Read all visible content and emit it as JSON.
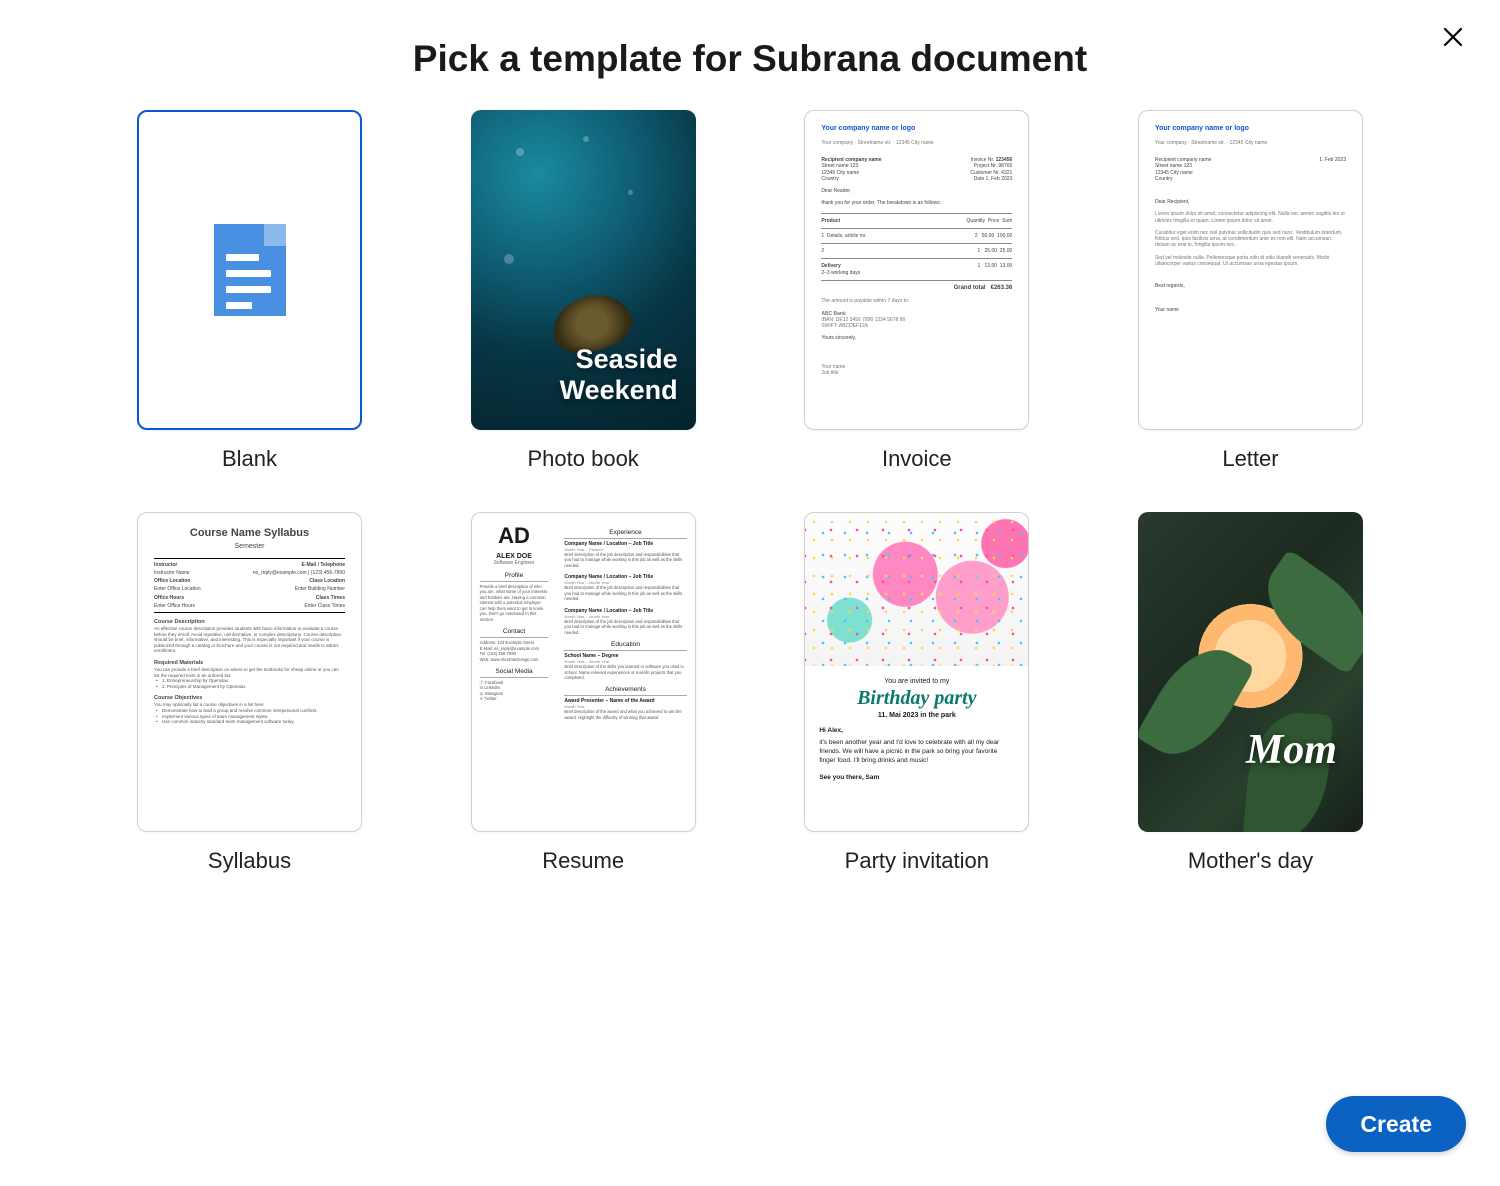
{
  "dialog": {
    "title": "Pick a template for Subrana document"
  },
  "templates": [
    {
      "label": "Blank",
      "selected": true
    },
    {
      "label": "Photo book",
      "overlay_line1": "Seaside",
      "overlay_line2": "Weekend"
    },
    {
      "label": "Invoice",
      "header": "Your company name or logo",
      "invoice_no_label": "Invoice Nr.",
      "invoice_no": "123456",
      "date_label": "Date",
      "date": "1. Feb 2023",
      "recipient_title": "Recipient company name",
      "greeting": "Dear Reader,",
      "intro": "thank you for your order. The breakdown is as follows:",
      "cols": [
        "Product",
        "Quantity",
        "Price",
        "Sum"
      ],
      "items": [
        {
          "name": "Details, article no.",
          "qty": 2,
          "price": "50.00",
          "sum": "100.00"
        },
        {
          "name": "",
          "qty": 1,
          "price": "25.00",
          "sum": "25.00"
        }
      ],
      "delivery_label": "Delivery",
      "delivery_desc": "2–3 working days",
      "grand_label": "Grand total",
      "grand": "€263.36",
      "signoff": "Yours sincerely,"
    },
    {
      "label": "Letter",
      "header": "Your company name or logo",
      "date": "1. Feb 2023",
      "greeting": "Dear Recipient,",
      "closing": "Best regards,",
      "signature": "Your name"
    },
    {
      "label": "Syllabus",
      "title": "Course Name Syllabus",
      "term": "Semester",
      "left_labels": [
        "Instructor",
        "Instructor Name",
        "Office Location",
        "Enter Office Location",
        "Office Hours",
        "Enter Office Hours"
      ],
      "right_labels": [
        "E-Mail / Telephone",
        "no_reply@example.com | (123) 456-7890",
        "Class Location",
        "Enter Building Number",
        "Class Times",
        "Enter Class Times"
      ],
      "sections": [
        "Course Description",
        "Required Materials",
        "Course Objectives"
      ]
    },
    {
      "label": "Resume",
      "initials": "AD",
      "name": "ALEX DOE",
      "role": "Software Engineer",
      "left_sections": [
        "Profile",
        "Contact",
        "Social Media"
      ],
      "right_sections": [
        "Experience",
        "Education",
        "Achievements"
      ],
      "job_line": "Company Name / Location – Job Title",
      "date_line": "Month Year – Present",
      "edu_line": "School Name – Degree",
      "award_line": "Award Presenter – Name of the Award",
      "socials": [
        "Facebook",
        "LinkedIn",
        "Instagram",
        "Twitter"
      ]
    },
    {
      "label": "Party invitation",
      "preline": "You are invited to my",
      "title": "Birthday party",
      "date": "11. Mai 2023 in the park",
      "hi": "Hi Alex,",
      "body": "it's been another year and I'd love to celebrate with all my dear friends. We will have a picnic in the park so bring your favorite finger food. I'll bring drinks and music!",
      "bye": "See you there, Sam"
    },
    {
      "label": "Mother's day",
      "overlay": "Mom"
    }
  ],
  "actions": {
    "create": "Create"
  }
}
